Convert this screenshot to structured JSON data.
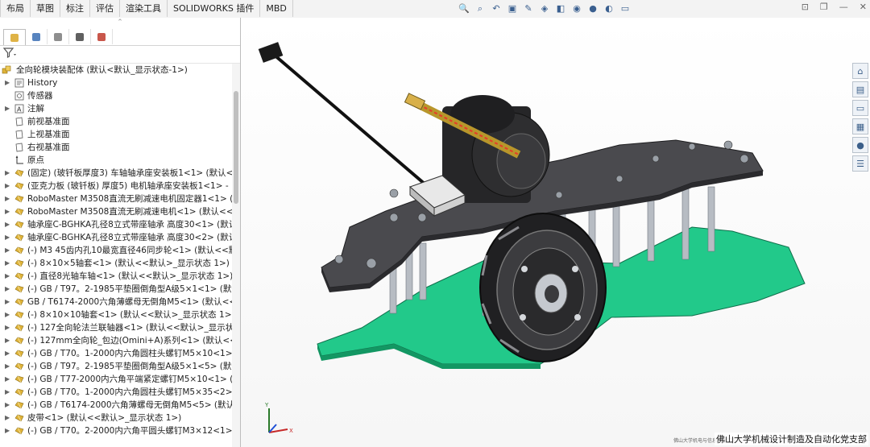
{
  "tabs": [
    "布局",
    "草图",
    "标注",
    "评估",
    "渲染工具",
    "SOLIDWORKS 插件",
    "MBD"
  ],
  "view_tools": [
    "zoom-to-fit-icon",
    "zoom-area-icon",
    "previous-view-icon",
    "section-view-icon",
    "dynamic-annotation-icon",
    "view-orientation-icon",
    "display-style-icon",
    "hide-show-icon",
    "appearance-icon",
    "scene-icon",
    "view-settings-icon"
  ],
  "window_controls": [
    "⊡",
    "❐",
    "—",
    "✕"
  ],
  "panel": {
    "tabs": [
      "feature-manager-icon",
      "property-manager-icon",
      "configuration-manager-icon",
      "dimxpert-icon",
      "display-manager-icon"
    ],
    "filter_icon": "filter-icon",
    "tree": [
      {
        "label": "全向轮模块装配体  (默认<默认_显示状态-1>)",
        "icon": "assembly",
        "indent": 0,
        "expand": false
      },
      {
        "label": "History",
        "icon": "history",
        "indent": 1,
        "expand": true
      },
      {
        "label": "传感器",
        "icon": "sensor",
        "indent": 1,
        "expand": false
      },
      {
        "label": "注解",
        "icon": "annotation",
        "indent": 1,
        "expand": true
      },
      {
        "label": "前视基准面",
        "icon": "plane",
        "indent": 1,
        "expand": false
      },
      {
        "label": "上视基准面",
        "icon": "plane",
        "indent": 1,
        "expand": false
      },
      {
        "label": "右视基准面",
        "icon": "plane",
        "indent": 1,
        "expand": false
      },
      {
        "label": "原点",
        "icon": "origin",
        "indent": 1,
        "expand": false
      },
      {
        "label": "(固定)  (玻钎板厚度3)  车轴轴承座安装板1<1>  (默认<<",
        "icon": "part",
        "indent": 1,
        "expand": true
      },
      {
        "label": "(亚克力板  (玻钎板)  厚度5)  电机轴承座安装板1<1>  -",
        "icon": "part",
        "indent": 1,
        "expand": true
      },
      {
        "label": "RoboMaster M3508直流无刷减速电机固定器1<1>  (默",
        "icon": "part",
        "indent": 1,
        "expand": true
      },
      {
        "label": "RoboMaster M3508直流无刷减速电机<1>  (默认<<默",
        "icon": "part",
        "indent": 1,
        "expand": true
      },
      {
        "label": "轴承座C-BGHKA孔径8立式带座轴承  高度30<1>  (默认<",
        "icon": "part",
        "indent": 1,
        "expand": true
      },
      {
        "label": "轴承座C-BGHKA孔径8立式带座轴承  高度30<2>  (默认<",
        "icon": "part",
        "indent": 1,
        "expand": true
      },
      {
        "label": "(-) M3 45齿内孔10最宽直径46同步轮<1>  (默认<<默认",
        "icon": "part",
        "indent": 1,
        "expand": true
      },
      {
        "label": "(-) 8×10×5轴套<1>  (默认<<默认>_显示状态 1>)",
        "icon": "part",
        "indent": 1,
        "expand": true
      },
      {
        "label": "(-) 直径8光轴车轴<1>  (默认<<默认>_显示状态 1>)",
        "icon": "part",
        "indent": 1,
        "expand": true
      },
      {
        "label": "(-) GB / T97。2-1985平垫圈倒角型A级5×1<1>  (默认<<",
        "icon": "part",
        "indent": 1,
        "expand": true
      },
      {
        "label": "GB / T6174-2000六角薄螺母无倒角M5<1>  (默认<<默",
        "icon": "part",
        "indent": 1,
        "expand": true
      },
      {
        "label": "(-) 8×10×10轴套<1>  (默认<<默认>_显示状态 1>)",
        "icon": "part",
        "indent": 1,
        "expand": true
      },
      {
        "label": "(-) 127全向轮法兰联轴器<1>  (默认<<默认>_显示状态",
        "icon": "part",
        "indent": 1,
        "expand": true
      },
      {
        "label": "(-) 127mm全向轮_包边(Omini+A)系列<1>  (默认<<默认",
        "icon": "part",
        "indent": 1,
        "expand": true
      },
      {
        "label": "(-) GB / T70。1-2000内六角圆柱头螺钉M5×10<1>  (默",
        "icon": "part",
        "indent": 1,
        "expand": true
      },
      {
        "label": "(-) GB / T97。2-1985平垫圈倒角型A级5×1<5>  (默认<<",
        "icon": "part",
        "indent": 1,
        "expand": true
      },
      {
        "label": "(-) GB / T77-2000内六角平端紧定螺钉M5×10<1>  (默认",
        "icon": "part",
        "indent": 1,
        "expand": true
      },
      {
        "label": "(-) GB / T70。1-2000内六角圆柱头螺钉M5×35<2>  (默",
        "icon": "part",
        "indent": 1,
        "expand": true
      },
      {
        "label": "(-) GB / T6174-2000六角薄螺母无倒角M5<5>  (默认<-",
        "icon": "part",
        "indent": 1,
        "expand": true
      },
      {
        "label": "皮带<1>  (默认<<默认>_显示状态 1>)",
        "icon": "part",
        "indent": 1,
        "expand": true
      },
      {
        "label": "(-) GB / T70。2-2000内六角平圆头螺钉M3×12<1>  (默",
        "icon": "part",
        "indent": 1,
        "expand": true
      }
    ]
  },
  "taskpane": [
    "home-icon",
    "design-library-icon",
    "file-explorer-icon",
    "view-palette-icon",
    "appearances-icon",
    "custom-properties-icon"
  ],
  "triad_icon": "coordinate-triad-icon",
  "watermark": "佛山大学机械设计制造及自动化党支部",
  "watermark_small": "佛山大学机电与信息工程学院",
  "colors": {
    "plate_dark": "#4a4a4e",
    "plate_green": "#22c98a",
    "tree_part_icon": "#e0b43a",
    "tab_bg": "#f3f3f3"
  }
}
